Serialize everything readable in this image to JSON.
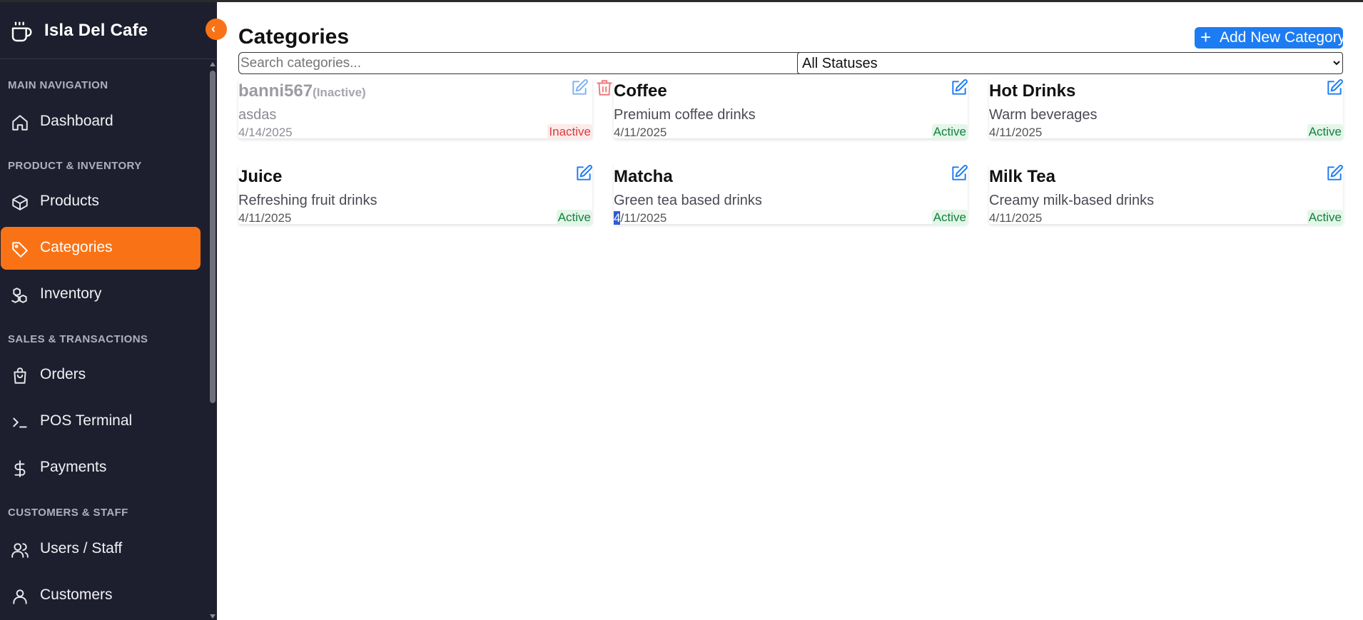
{
  "app": {
    "name": "Isla Del Cafe"
  },
  "sidebar": {
    "sections": {
      "main_navigation": "MAIN NAVIGATION",
      "product_inventory": "PRODUCT & INVENTORY",
      "sales_transactions": "SALES & TRANSACTIONS",
      "customers_staff": "CUSTOMERS & STAFF"
    },
    "items": {
      "dashboard": "Dashboard",
      "products": "Products",
      "categories": "Categories",
      "inventory": "Inventory",
      "orders": "Orders",
      "pos_terminal": "POS Terminal",
      "payments": "Payments",
      "users_staff": "Users / Staff",
      "customers": "Customers"
    },
    "active_item": "categories"
  },
  "page": {
    "title": "Categories",
    "add_button_label": "Add New Category",
    "search_placeholder": "Search categories...",
    "status_filter_selected": "All Statuses"
  },
  "categories": [
    {
      "name": "banni567",
      "inactive_tag": "(Inactive)",
      "description": "asdas",
      "date": "4/14/2025",
      "status": "Inactive"
    },
    {
      "name": "Coffee",
      "description": "Premium coffee drinks",
      "date": "4/11/2025",
      "status": "Active"
    },
    {
      "name": "Hot Drinks",
      "description": "Warm beverages",
      "date": "4/11/2025",
      "status": "Active"
    },
    {
      "name": "Juice",
      "description": "Refreshing fruit drinks",
      "date": "4/11/2025",
      "status": "Active"
    },
    {
      "name": "Matcha",
      "description": "Green tea based drinks",
      "date_prefix": "4",
      "date_rest": "/11/2025",
      "status": "Active"
    },
    {
      "name": "Milk Tea",
      "description": "Creamy milk-based drinks",
      "date": "4/11/2025",
      "status": "Active"
    }
  ],
  "colors": {
    "sidebar_bg": "#1e1f2e",
    "accent": "#f97316",
    "primary_button": "#1d7cf2",
    "active_green": "#15803d",
    "inactive_red": "#dc3b3b"
  },
  "icons": {
    "brand": "coffee-cup-icon",
    "dashboard": "home-icon",
    "products": "box-icon",
    "categories": "tag-icon",
    "inventory": "boxes-icon",
    "orders": "shopping-bag-icon",
    "pos_terminal": "terminal-icon",
    "payments": "dollar-icon",
    "users_staff": "users-icon",
    "customers": "user-icon",
    "edit": "edit-icon",
    "delete": "trash-icon"
  }
}
